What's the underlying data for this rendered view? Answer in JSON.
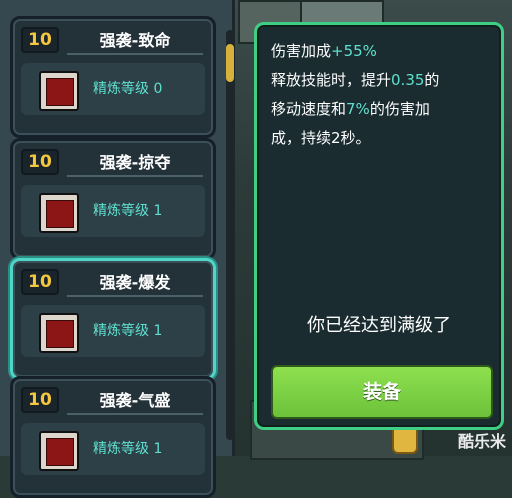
{
  "skills": [
    {
      "level": "10",
      "title": "强袭-致命",
      "refine": "精炼等级 0",
      "selected": false
    },
    {
      "level": "10",
      "title": "强袭-掠夺",
      "refine": "精炼等级 1",
      "selected": false
    },
    {
      "level": "10",
      "title": "强袭-爆发",
      "refine": "精炼等级 1",
      "selected": true
    },
    {
      "level": "10",
      "title": "强袭-气盛",
      "refine": "精炼等级 1",
      "selected": false
    }
  ],
  "tooltip": {
    "line1_label": "伤害加成",
    "line1_value": "+55%",
    "line2a": "释放技能时，提升",
    "line2_value": "0.35",
    "line2b": "的",
    "line3a": "移动速度和",
    "line3_value": "7%",
    "line3b": "的伤害加",
    "line4": "成，持续2秒。",
    "maxed_text": "你已经达到满级了",
    "equip_label": "装备"
  },
  "watermark": "酷乐米",
  "colors": {
    "accent": "#5fe0cf",
    "border": "#3fcf84",
    "level": "#f4c73e",
    "equip": "#7bd145"
  }
}
